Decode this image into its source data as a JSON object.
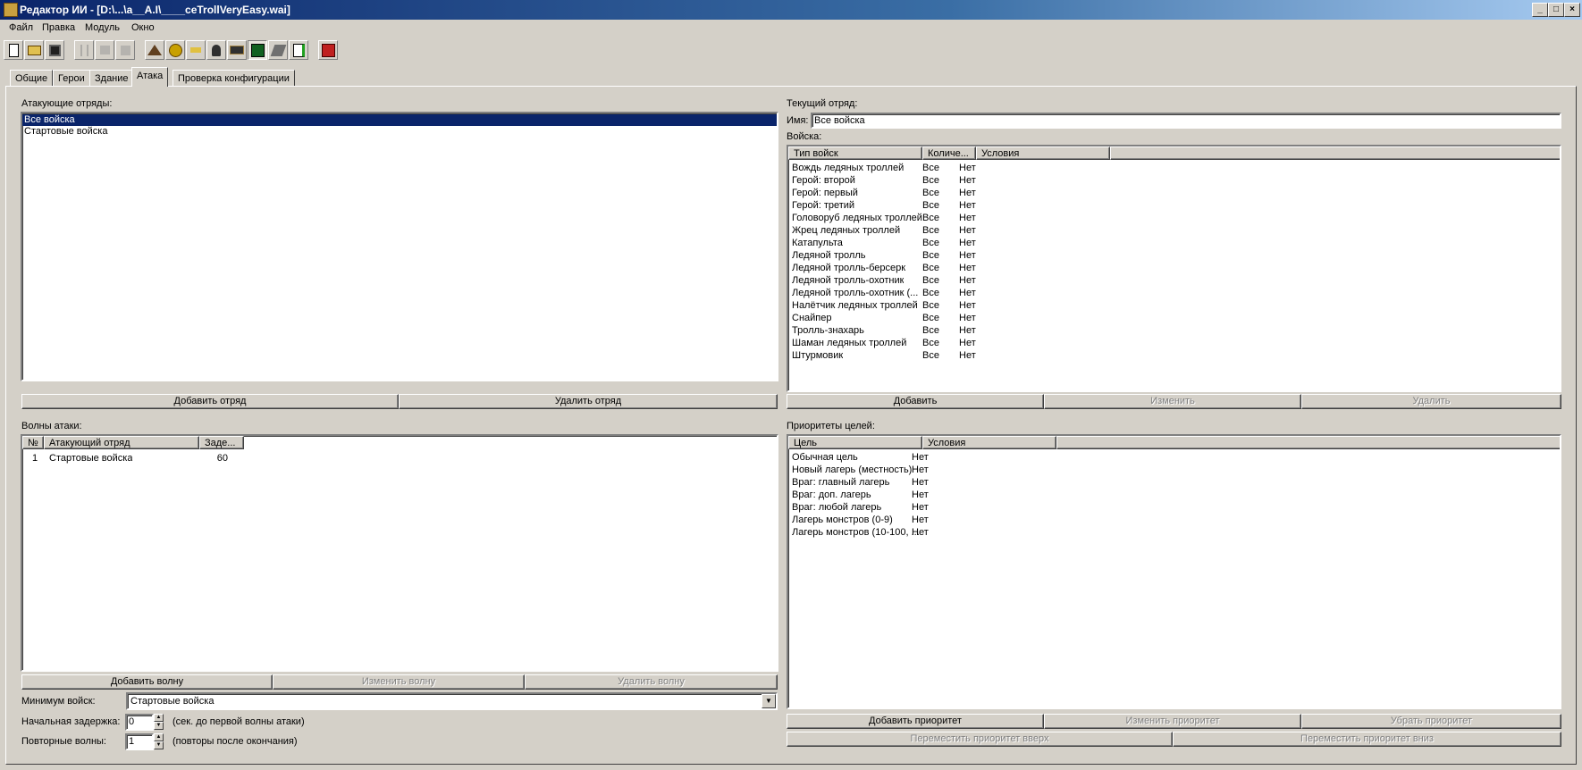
{
  "window": {
    "title": "Редактор ИИ - [D:\\...\\a__A.I\\____ceTrollVeryEasy.wai]",
    "min_glyph": "_",
    "max_glyph": "□",
    "close_glyph": "×"
  },
  "menu": [
    "Файл",
    "Правка",
    "Модуль",
    "Окно"
  ],
  "toolbar": {
    "icons": [
      "new-file-icon",
      "open-folder-icon",
      "save-icon",
      "cut-icon",
      "copy-icon",
      "paste-icon",
      "terrain-icon",
      "gold-icon",
      "lumber-icon",
      "hero-icon",
      "building-icon",
      "attack-icon",
      "book-icon",
      "export-icon",
      "test-icon"
    ]
  },
  "tabs": [
    "Общие",
    "Герои",
    "Здание",
    "Атака",
    "Проверка конфигурации"
  ],
  "attack_groups": {
    "label": "Атакующие отряды:",
    "items": [
      "Все войска",
      "Стартовые войска"
    ],
    "selected_index": 0,
    "add_button": "Добавить отряд",
    "remove_button": "Удалить отряд"
  },
  "waves": {
    "label": "Волны атаки:",
    "columns": [
      "№",
      "Атакующий отряд",
      "Заде..."
    ],
    "rows": [
      {
        "num": "1",
        "group": "Стартовые войска",
        "delay": "60"
      }
    ],
    "add_button": "Добавить волну",
    "edit_button": "Изменить волну",
    "remove_button": "Удалить волну",
    "min_troops_label": "Минимум войск:",
    "min_troops_value": "Стартовые войска",
    "initial_delay_label": "Начальная задержка:",
    "initial_delay_value": "0",
    "initial_delay_hint": "(сек. до первой волны атаки)",
    "repeat_label": "Повторные волны:",
    "repeat_value": "1",
    "repeat_hint": "(повторы после окончания)"
  },
  "current_group": {
    "label": "Текущий отряд:",
    "name_label": "Имя:",
    "name_value": "Все войска",
    "troops_label": "Войска:",
    "columns": [
      "Тип войск",
      "Количе...",
      "Условия"
    ],
    "rows": [
      {
        "type": "Вождь ледяных троллей",
        "count": "Все",
        "cond": "Нет"
      },
      {
        "type": "Герой: второй",
        "count": "Все",
        "cond": "Нет"
      },
      {
        "type": "Герой: первый",
        "count": "Все",
        "cond": "Нет"
      },
      {
        "type": "Герой: третий",
        "count": "Все",
        "cond": "Нет"
      },
      {
        "type": "Головоруб ледяных троллей",
        "count": "Все",
        "cond": "Нет"
      },
      {
        "type": "Жрец ледяных троллей",
        "count": "Все",
        "cond": "Нет"
      },
      {
        "type": "Катапульта",
        "count": "Все",
        "cond": "Нет"
      },
      {
        "type": "Ледяной тролль",
        "count": "Все",
        "cond": "Нет"
      },
      {
        "type": "Ледяной тролль-берсерк",
        "count": "Все",
        "cond": "Нет"
      },
      {
        "type": "Ледяной тролль-охотник",
        "count": "Все",
        "cond": "Нет"
      },
      {
        "type": "Ледяной тролль-охотник (...",
        "count": "Все",
        "cond": "Нет"
      },
      {
        "type": "Налётчик ледяных троллей",
        "count": "Все",
        "cond": "Нет"
      },
      {
        "type": "Снайпер",
        "count": "Все",
        "cond": "Нет"
      },
      {
        "type": "Тролль-знахарь",
        "count": "Все",
        "cond": "Нет"
      },
      {
        "type": "Шаман ледяных троллей",
        "count": "Все",
        "cond": "Нет"
      },
      {
        "type": "Штурмовик",
        "count": "Все",
        "cond": "Нет"
      }
    ],
    "add_button": "Добавить",
    "edit_button": "Изменить",
    "remove_button": "Удалить"
  },
  "priorities": {
    "label": "Приоритеты целей:",
    "columns": [
      "Цель",
      "Условия"
    ],
    "rows": [
      {
        "target": "Обычная цель",
        "cond": "Нет"
      },
      {
        "target": "Новый лагерь (местность)",
        "cond": "Нет"
      },
      {
        "target": "Враг: главный лагерь",
        "cond": "Нет"
      },
      {
        "target": "Враг: доп. лагерь",
        "cond": "Нет"
      },
      {
        "target": "Враг: любой лагерь",
        "cond": "Нет"
      },
      {
        "target": "Лагерь монстров (0-9)",
        "cond": "Нет"
      },
      {
        "target": "Лагерь монстров (10-100, ...",
        "cond": "Нет"
      }
    ],
    "add_button": "Добавить приоритет",
    "edit_button": "Изменить приоритет",
    "remove_button": "Убрать приоритет",
    "move_up_button": "Переместить приоритет вверх",
    "move_down_button": "Переместить приоритет вниз"
  }
}
